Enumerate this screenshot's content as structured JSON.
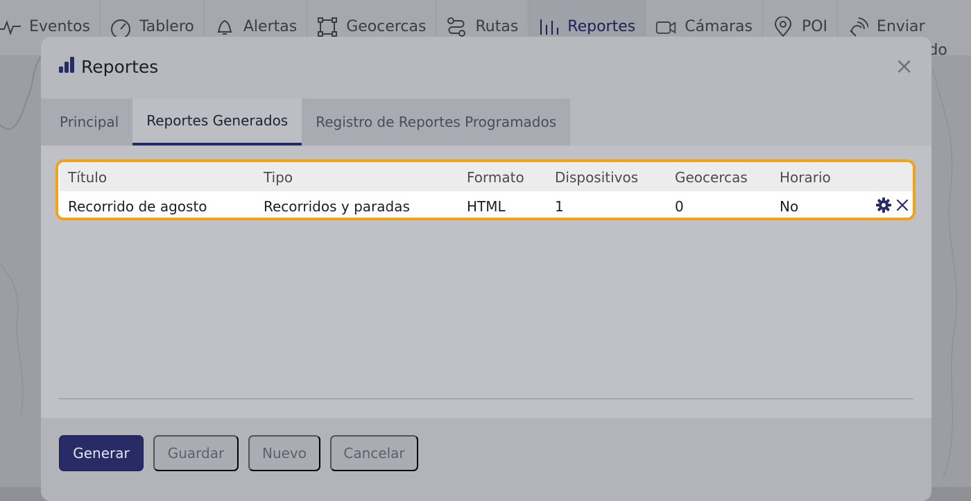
{
  "nav": {
    "items": [
      {
        "label": "Eventos",
        "icon": "activity-icon"
      },
      {
        "label": "Tablero",
        "icon": "gauge-icon"
      },
      {
        "label": "Alertas",
        "icon": "bell-icon"
      },
      {
        "label": "Geocercas",
        "icon": "geofence-icon"
      },
      {
        "label": "Rutas",
        "icon": "route-icon"
      },
      {
        "label": "Reportes",
        "icon": "bar-chart-icon",
        "active": true
      },
      {
        "label": "Cámaras",
        "icon": "camera-icon"
      },
      {
        "label": "POI",
        "icon": "map-pin-icon"
      },
      {
        "label": "Enviar comando",
        "icon": "satellite-icon"
      }
    ]
  },
  "modal": {
    "title": "Reportes",
    "close_label": "×",
    "tabs": [
      {
        "label": "Principal"
      },
      {
        "label": "Reportes Generados",
        "active": true
      },
      {
        "label": "Registro de Reportes Programados"
      }
    ]
  },
  "table": {
    "columns": [
      "Título",
      "Tipo",
      "Formato",
      "Dispositivos",
      "Geocercas",
      "Horario"
    ],
    "rows": [
      {
        "titulo": "Recorrido de agosto",
        "tipo": "Recorridos y paradas",
        "formato": "HTML",
        "dispositivos": "1",
        "geocercas": "0",
        "horario": "No"
      }
    ]
  },
  "footer": {
    "buttons": [
      {
        "label": "Generar",
        "style": "primary"
      },
      {
        "label": "Guardar",
        "style": "secondary"
      },
      {
        "label": "Nuevo",
        "style": "secondary"
      },
      {
        "label": "Cancelar",
        "style": "secondary"
      }
    ]
  },
  "colors": {
    "accent": "#272b66",
    "highlight": "#f0a21a"
  }
}
